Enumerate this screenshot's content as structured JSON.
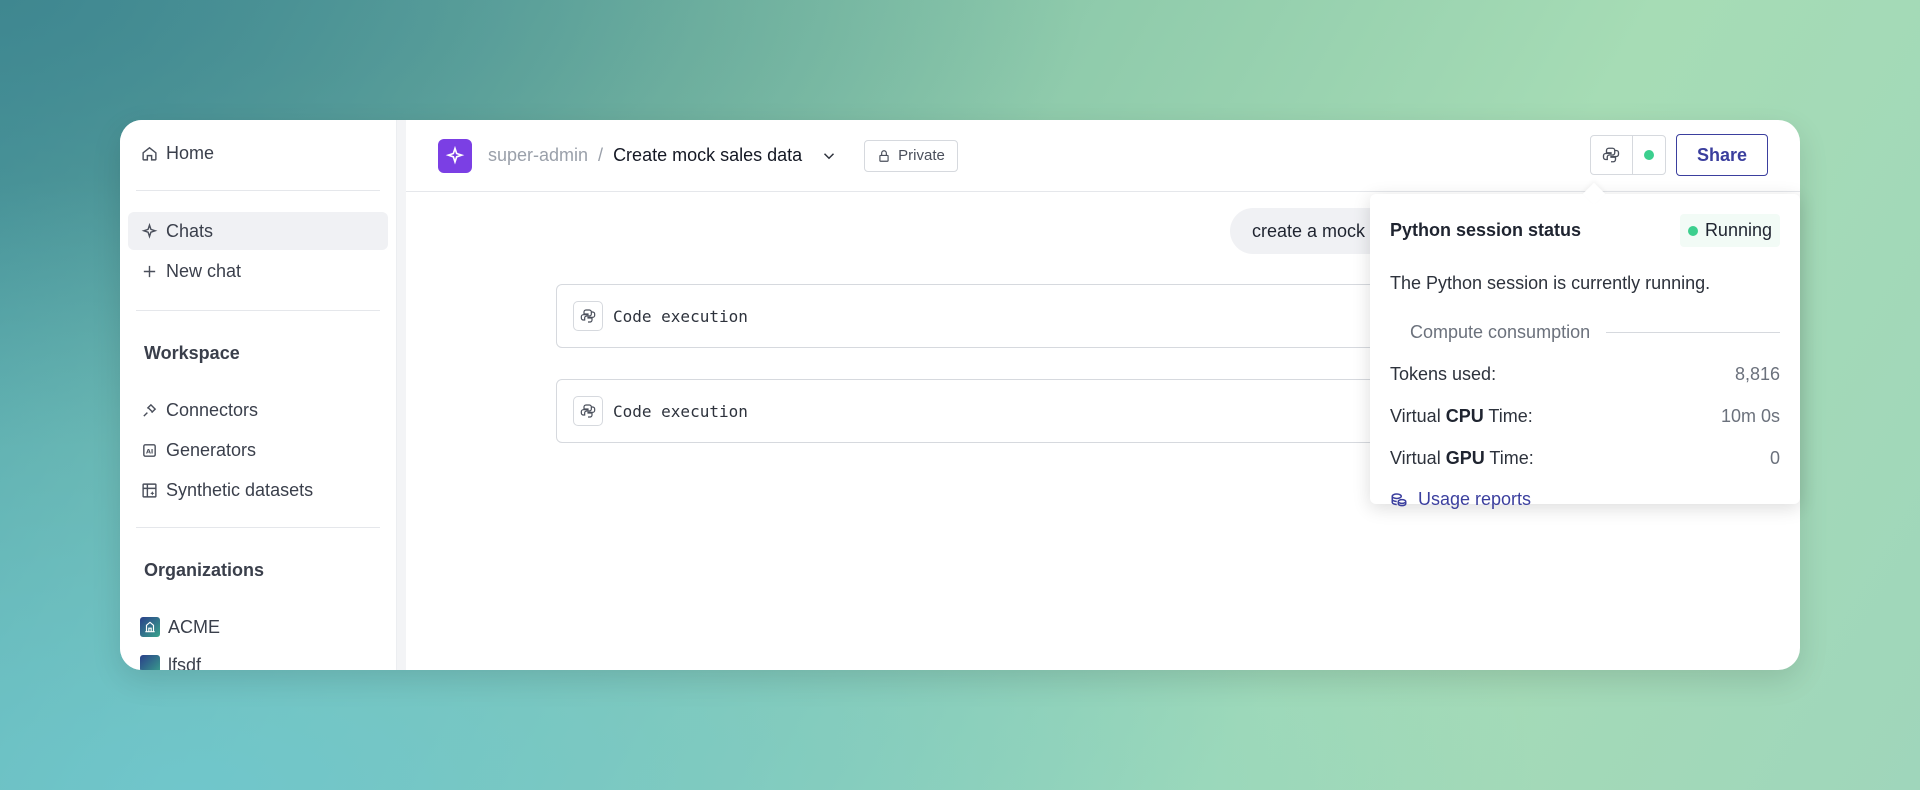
{
  "sidebar": {
    "home_label": "Home",
    "chats_label": "Chats",
    "new_chat_label": "New chat",
    "workspace_heading": "Workspace",
    "workspace_items": [
      "Connectors",
      "Generators",
      "Synthetic datasets"
    ],
    "organizations_heading": "Organizations",
    "organizations": [
      "ACME",
      "lfsdf"
    ]
  },
  "header": {
    "owner": "super-admin",
    "separator": "/",
    "title": "Create mock sales data",
    "visibility": "Private",
    "share_label": "Share"
  },
  "chat": {
    "user_message": "create a mock s",
    "code_cards": [
      "Code execution",
      "Code execution"
    ]
  },
  "popover": {
    "title": "Python session status",
    "status": "Running",
    "description": "The Python session is currently running.",
    "section_label": "Compute consumption",
    "tokens_label": "Tokens used:",
    "tokens_value": "8,816",
    "cpu_prefix": "Virtual ",
    "cpu_strong": "CPU",
    "cpu_suffix": " Time:",
    "cpu_value": "10m 0s",
    "gpu_prefix": "Virtual ",
    "gpu_strong": "GPU",
    "gpu_suffix": " Time:",
    "gpu_value": "0",
    "usage_link": "Usage reports"
  },
  "colors": {
    "accent": "#3b3f9e",
    "app_badge": "#7b3fe4",
    "running": "#3ccf8e"
  }
}
